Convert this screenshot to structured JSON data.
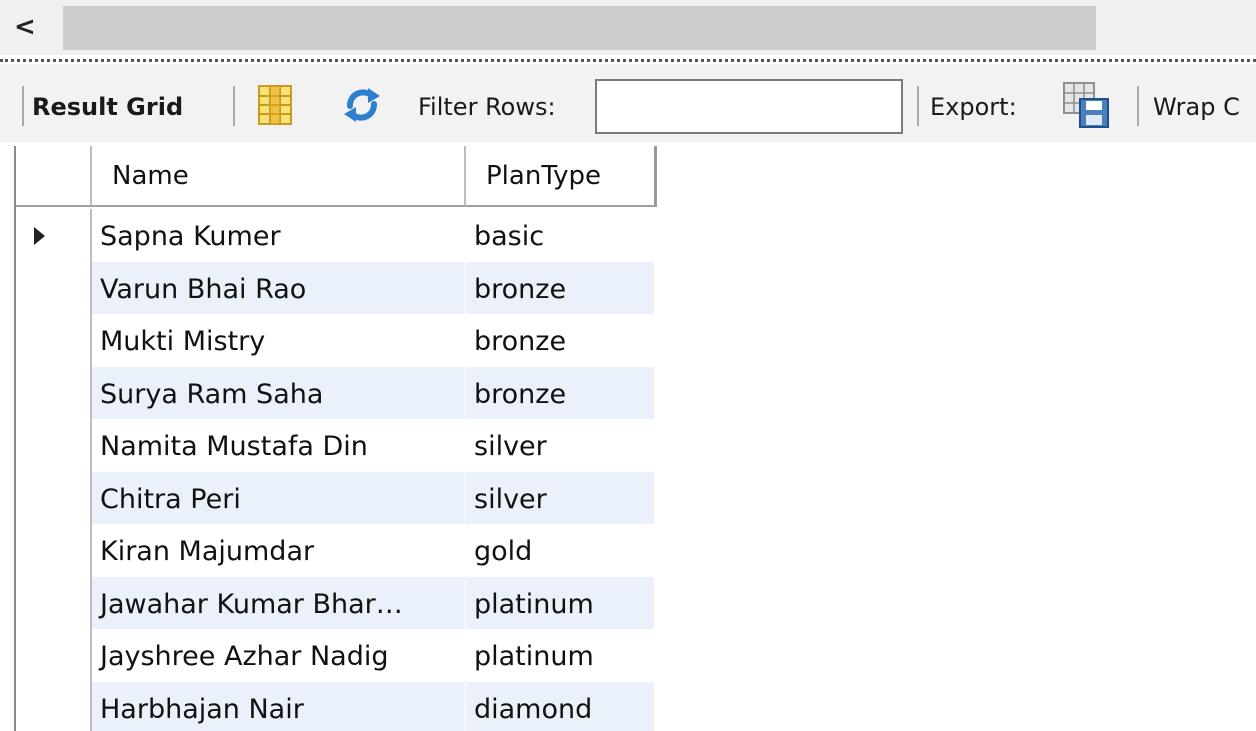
{
  "scrollbar": {
    "left_arrow_glyph": "<"
  },
  "toolbar": {
    "result_grid_label": "Result Grid",
    "filter_label": "Filter Rows:",
    "filter_value": "",
    "export_label": "Export:",
    "wrap_label": "Wrap C",
    "icons": [
      "grid-layout-icon",
      "refresh-icon",
      "export-save-icon"
    ]
  },
  "grid": {
    "columns": [
      "Name",
      "PlanType"
    ],
    "rows": [
      {
        "name": "Sapna Kumer",
        "plan": "basic"
      },
      {
        "name": "Varun Bhai Rao",
        "plan": "bronze"
      },
      {
        "name": "Mukti Mistry",
        "plan": "bronze"
      },
      {
        "name": "Surya Ram Saha",
        "plan": "bronze"
      },
      {
        "name": "Namita Mustafa Din",
        "plan": "silver"
      },
      {
        "name": "Chitra Peri",
        "plan": "silver"
      },
      {
        "name": "Kiran Majumdar",
        "plan": "gold"
      },
      {
        "name": "Jawahar Kumar Bhar…",
        "plan": "platinum"
      },
      {
        "name": "Jayshree Azhar Nadig",
        "plan": "platinum"
      },
      {
        "name": "Harbhajan Nair",
        "plan": "diamond"
      }
    ],
    "current_row": 0,
    "alt_row_color": "#eaf1fb"
  }
}
